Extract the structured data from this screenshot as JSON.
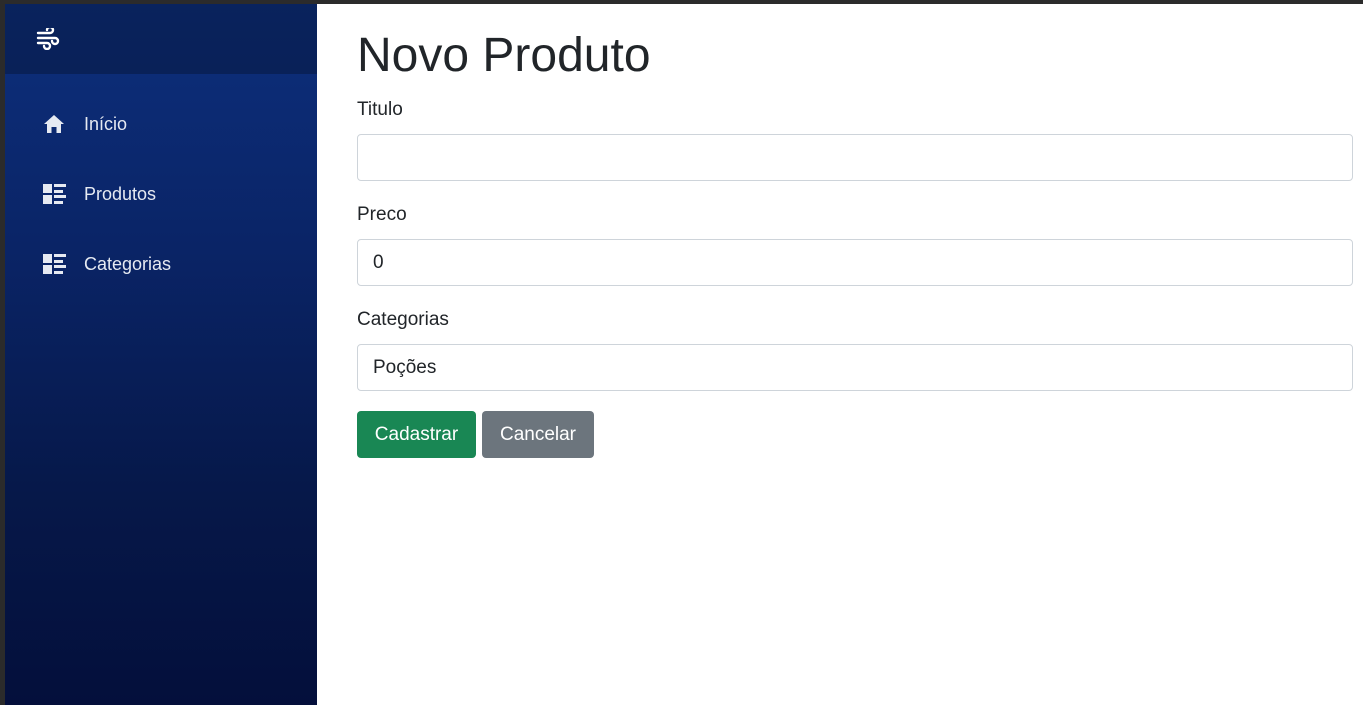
{
  "sidebar": {
    "brand_icon": "wind-icon",
    "items": [
      {
        "label": "Início",
        "icon": "home-icon"
      },
      {
        "label": "Produtos",
        "icon": "list-icon"
      },
      {
        "label": "Categorias",
        "icon": "list-icon"
      }
    ]
  },
  "main": {
    "title": "Novo Produto",
    "fields": {
      "titulo": {
        "label": "Titulo",
        "value": ""
      },
      "preco": {
        "label": "Preco",
        "value": "0"
      },
      "categorias": {
        "label": "Categorias",
        "selected": "Poções"
      }
    },
    "buttons": {
      "submit": "Cadastrar",
      "cancel": "Cancelar"
    }
  },
  "colors": {
    "sidebar_top": "#0d2f7c",
    "sidebar_bottom": "#040f3b",
    "success": "#198754",
    "secondary": "#6c757d"
  }
}
